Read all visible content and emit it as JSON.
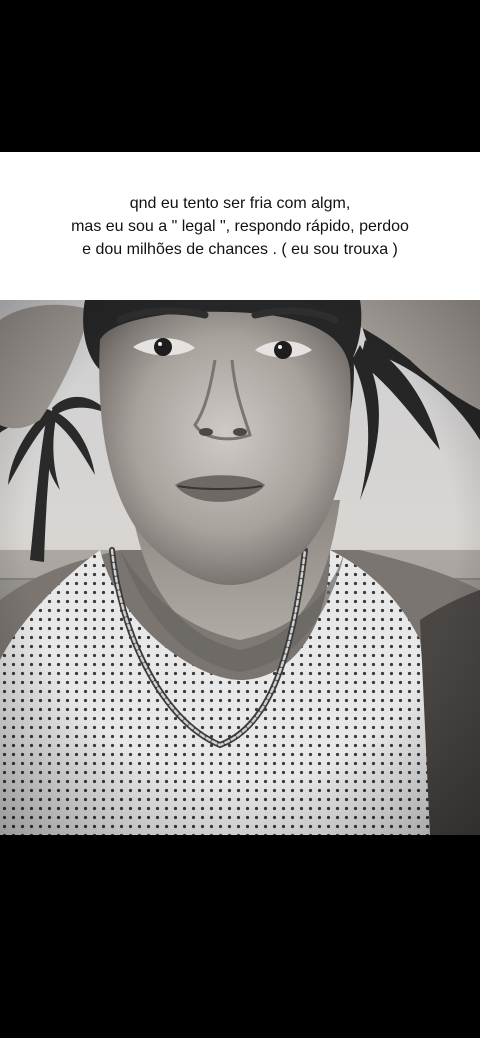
{
  "caption": {
    "lines": [
      "qnd eu tento ser fria com algm,",
      "mas eu sou a \" legal \", respondo rápido, perdoo",
      "e dou milhões de chances . ( eu sou trouxa )"
    ]
  },
  "photo": {
    "subject": "black-and-white selfie of a young man in a mesh tank top with a chain necklace, hands raised to his head, palm trees and sunset sky behind",
    "tone": "monochrome"
  },
  "colors": {
    "background": "#000000",
    "caption_panel": "#ffffff",
    "caption_text": "#111111"
  }
}
